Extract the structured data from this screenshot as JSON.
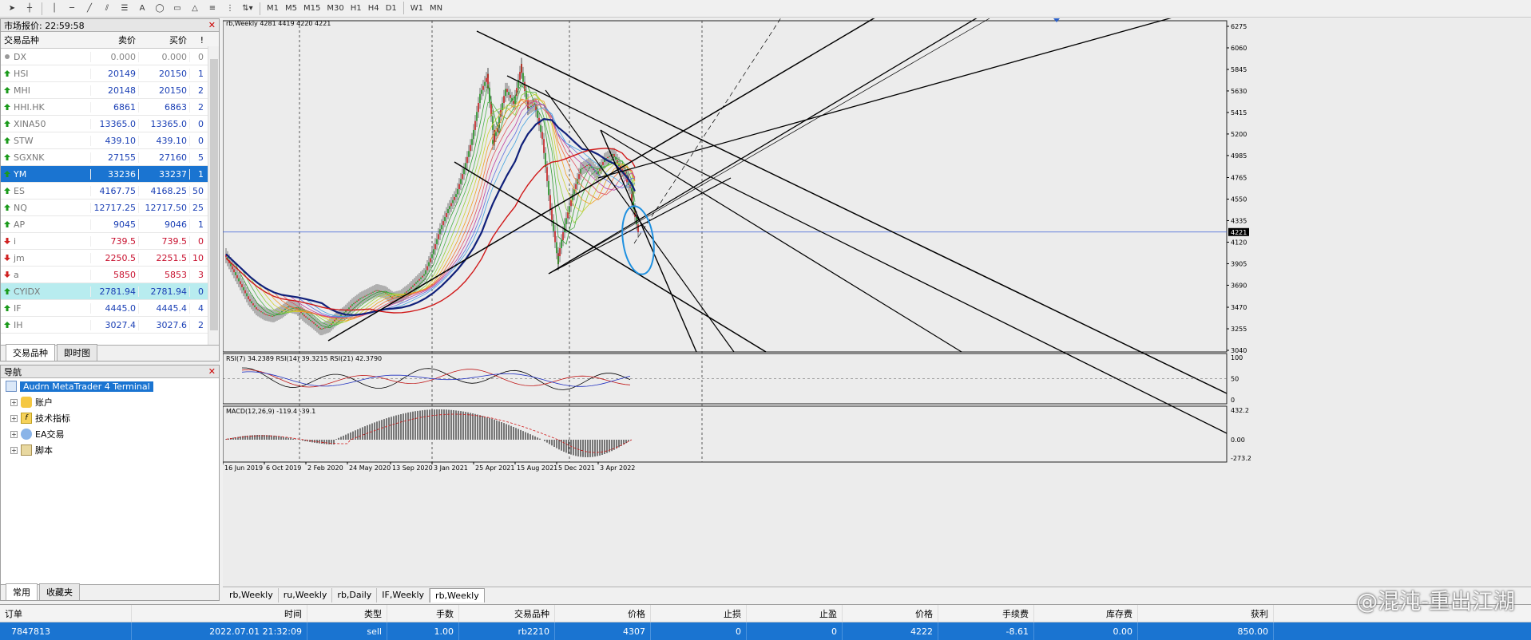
{
  "toolbar": {
    "timeframes": [
      "M1",
      "M5",
      "M15",
      "M30",
      "H1",
      "H4",
      "D1",
      "W1",
      "MN"
    ]
  },
  "market_watch": {
    "title": "市场报价: 22:59:58",
    "col_symbol": "交易品种",
    "col_bid": "卖价",
    "col_ask": "买价",
    "col_mark": "!",
    "rows": [
      {
        "symbol": "DX",
        "bid": "0.000",
        "ask": "0.000",
        "n": "0",
        "color": "#888888",
        "dir": "neutral"
      },
      {
        "symbol": "HSI",
        "bid": "20149",
        "ask": "20150",
        "n": "1",
        "color": "#1a3fb5",
        "dir": "up"
      },
      {
        "symbol": "MHI",
        "bid": "20148",
        "ask": "20150",
        "n": "2",
        "color": "#1a3fb5",
        "dir": "up"
      },
      {
        "symbol": "HHI.HK",
        "bid": "6861",
        "ask": "6863",
        "n": "2",
        "color": "#1a3fb5",
        "dir": "up"
      },
      {
        "symbol": "XINA50",
        "bid": "13365.0",
        "ask": "13365.0",
        "n": "0",
        "color": "#1a3fb5",
        "dir": "up"
      },
      {
        "symbol": "STW",
        "bid": "439.10",
        "ask": "439.10",
        "n": "0",
        "color": "#1a3fb5",
        "dir": "up"
      },
      {
        "symbol": "SGXNK",
        "bid": "27155",
        "ask": "27160",
        "n": "5",
        "color": "#1a3fb5",
        "dir": "up"
      },
      {
        "symbol": "YM",
        "bid": "33236",
        "ask": "33237",
        "n": "1",
        "color": "#ffffff",
        "dir": "up"
      },
      {
        "symbol": "ES",
        "bid": "4167.75",
        "ask": "4168.25",
        "n": "50",
        "color": "#1a3fb5",
        "dir": "up"
      },
      {
        "symbol": "NQ",
        "bid": "12717.25",
        "ask": "12717.50",
        "n": "25",
        "color": "#1a3fb5",
        "dir": "up"
      },
      {
        "symbol": "AP",
        "bid": "9045",
        "ask": "9046",
        "n": "1",
        "color": "#1a3fb5",
        "dir": "up"
      },
      {
        "symbol": "i",
        "bid": "739.5",
        "ask": "739.5",
        "n": "0",
        "color": "#c8102e",
        "dir": "down"
      },
      {
        "symbol": "jm",
        "bid": "2250.5",
        "ask": "2251.5",
        "n": "10",
        "color": "#c8102e",
        "dir": "down"
      },
      {
        "symbol": "a",
        "bid": "5850",
        "ask": "5853",
        "n": "3",
        "color": "#c8102e",
        "dir": "down"
      },
      {
        "symbol": "CYIDX",
        "bid": "2781.94",
        "ask": "2781.94",
        "n": "0",
        "color": "#1a3fb5",
        "dir": "up"
      },
      {
        "symbol": "IF",
        "bid": "4445.0",
        "ask": "4445.4",
        "n": "4",
        "color": "#1a3fb5",
        "dir": "up"
      },
      {
        "symbol": "IH",
        "bid": "3027.4",
        "ask": "3027.6",
        "n": "2",
        "color": "#1a3fb5",
        "dir": "up"
      }
    ],
    "tabs": [
      "交易品种",
      "即时图"
    ]
  },
  "navigator": {
    "title": "导航",
    "root": "Audrn MetaTrader 4 Terminal",
    "items": [
      "账户",
      "技术指标",
      "EA交易",
      "脚本"
    ],
    "tabs": [
      "常用",
      "收藏夹"
    ]
  },
  "chart": {
    "header": "rb,Weekly  4281 4419 4220 4221",
    "rsi_label": "RSI(7) 34.2389   RSI(14) 39.3215   RSI(21) 42.3790",
    "macd_label": "MACD(12,26,9) -119.4 -39.1",
    "price_axis": [
      "6275",
      "6060",
      "5845",
      "5630",
      "5415",
      "5200",
      "4985",
      "4765",
      "4550",
      "4335",
      "4120",
      "3905",
      "3690",
      "3470",
      "3255",
      "3040"
    ],
    "current_price": "4221",
    "rsi_axis": [
      "100",
      "50",
      "0"
    ],
    "macd_axis": [
      "432.2",
      "0.00",
      "-273.2"
    ],
    "date_axis": [
      "16 Jun 2019",
      "6 Oct 2019",
      "2 Feb 2020",
      "24 May 2020",
      "13 Sep 2020",
      "3 Jan 2021",
      "25 Apr 2021",
      "15 Aug 2021",
      "5 Dec 2021",
      "3 Apr 2022"
    ]
  },
  "chart_tabs": [
    "rb,Weekly",
    "ru,Weekly",
    "rb,Daily",
    "IF,Weekly",
    "rb,Weekly"
  ],
  "terminal": {
    "headers": [
      "订单",
      "时间",
      "类型",
      "手数",
      "交易品种",
      "价格",
      "止损",
      "止盈",
      "价格",
      "手续费",
      "库存费",
      "获利"
    ],
    "row": [
      "7847813",
      "2022.07.01 21:32:09",
      "sell",
      "1.00",
      "rb2210",
      "4307",
      "0",
      "0",
      "4222",
      "-8.61",
      "0.00",
      "850.00"
    ]
  },
  "watermark": "@混沌-重出江湖",
  "colors": {
    "up": "#1a9a1a",
    "down": "#d02020",
    "select": "#1a74d1",
    "ma_red": "#d01818",
    "ma_navy": "#10207a",
    "circle": "#1e90e0"
  }
}
